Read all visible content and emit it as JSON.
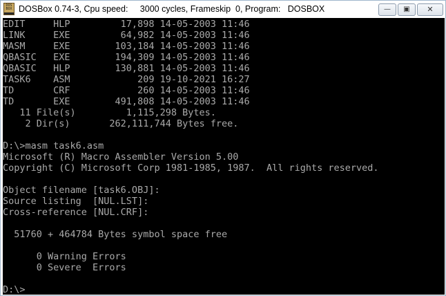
{
  "window": {
    "title": "DOSBox 0.74-3, Cpu speed:     3000 cycles, Frameskip  0, Program:   DOSBOX",
    "icon_text": "DOS BOX",
    "controls": {
      "minimize_icon": "minimize-icon",
      "maximize_icon": "maximize-icon",
      "close_icon": "close-icon"
    }
  },
  "console": {
    "lines": [
      "EDIT     HLP         17,898 14-05-2003 11:46",
      "LINK     EXE         64,982 14-05-2003 11:46",
      "MASM     EXE        103,184 14-05-2003 11:46",
      "QBASIC   EXE        194,309 14-05-2003 11:46",
      "QBASIC   HLP        130,881 14-05-2003 11:46",
      "TASK6    ASM            209 19-10-2021 16:27",
      "TD       CRF            260 14-05-2003 11:46",
      "TD       EXE        491,808 14-05-2003 11:46",
      "   11 File(s)         1,115,298 Bytes.",
      "    2 Dir(s)       262,111,744 Bytes free.",
      "",
      "D:\\>masm task6.asm",
      "Microsoft (R) Macro Assembler Version 5.00",
      "Copyright (C) Microsoft Corp 1981-1985, 1987.  All rights reserved.",
      "",
      "Object filename [task6.OBJ]:",
      "Source listing  [NUL.LST]:",
      "Cross-reference [NUL.CRF]:",
      "",
      "  51760 + 464784 Bytes symbol space free",
      "",
      "      0 Warning Errors",
      "      0 Severe  Errors",
      "",
      "D:\\>"
    ]
  },
  "colors": {
    "console_bg": "#000000",
    "console_text": "#aaaaaa"
  }
}
